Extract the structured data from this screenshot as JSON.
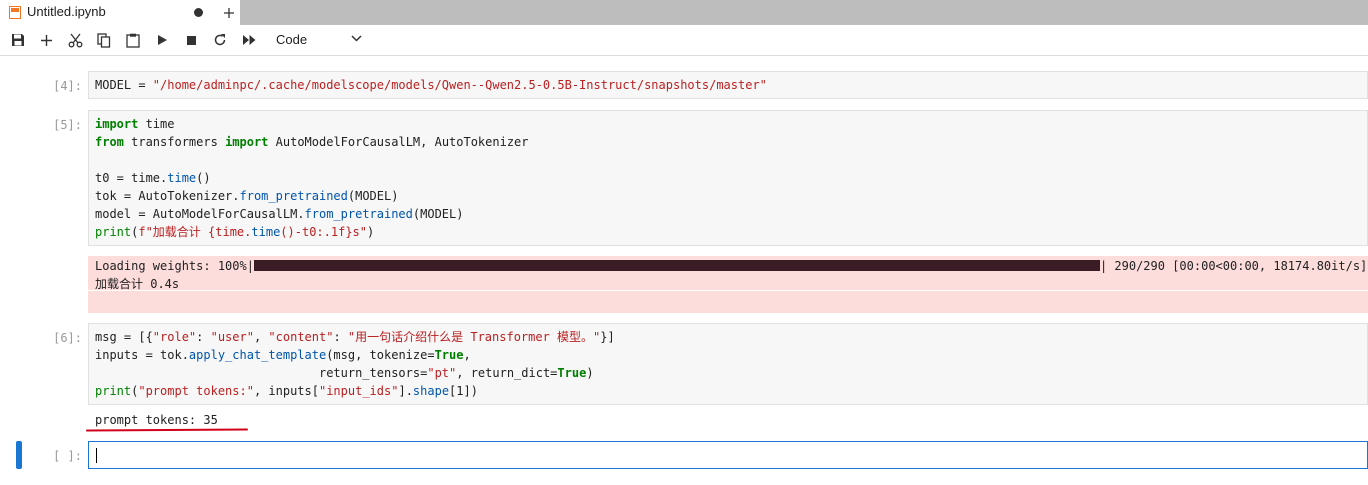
{
  "tab": {
    "title": "Untitled.ipynb",
    "new_tab_label": "+"
  },
  "toolbar": {
    "cell_type": "Code",
    "icons": [
      "save-icon",
      "add-icon",
      "cut-icon",
      "copy-icon",
      "paste-icon",
      "run-icon",
      "stop-icon",
      "restart-icon",
      "fast-forward-icon"
    ]
  },
  "colors": {
    "accent": "#1976d2",
    "stderr_bg": "#fddcdc",
    "keyword": "#008000",
    "string": "#ba2121"
  },
  "cells": [
    {
      "prompt": "[4]:",
      "lines": [
        "MODEL = \"/home/adminpc/.cache/modelscope/models/Qwen--Qwen2.5-0.5B-Instruct/snapshots/master\""
      ]
    },
    {
      "prompt": "[5]:",
      "lines": [
        "import time",
        "from transformers import AutoModelForCausalLM, AutoTokenizer",
        "",
        "t0 = time.time()",
        "tok = AutoTokenizer.from_pretrained(MODEL)",
        "model = AutoModelForCausalLM.from_pretrained(MODEL)",
        "print(f\"加载合计 {time.time()-t0:.1f}s\")"
      ],
      "output": {
        "progress_label": "Loading weights: 100%|",
        "progress_percent": 100,
        "progress_stats": "| 290/290 [00:00<00:00, 18174.80it/s]",
        "result": "加载合计 0.4s"
      }
    },
    {
      "prompt": "[6]:",
      "lines": [
        "msg = [{\"role\": \"user\", \"content\": \"用一句话介绍什么是 Transformer 模型。\"}]",
        "inputs = tok.apply_chat_template(msg, tokenize=True,",
        "                               return_tensors=\"pt\", return_dict=True)",
        "print(\"prompt tokens:\", inputs[\"input_ids\"].shape[1])"
      ],
      "output": {
        "result": "prompt tokens: 35"
      }
    },
    {
      "prompt": "[ ]:",
      "lines": [
        ""
      ]
    }
  ]
}
